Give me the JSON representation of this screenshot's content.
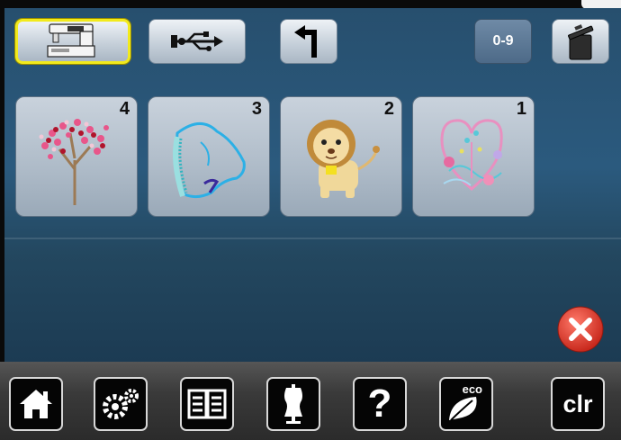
{
  "toolbar": {
    "machine_memory": "machine-icon",
    "usb_memory": "usb-icon",
    "back": "back-arrow-icon",
    "numeric_label": "0-9",
    "delete": "trash-icon"
  },
  "designs": [
    {
      "number": "4",
      "motif": "cherry-blossom-tree"
    },
    {
      "number": "3",
      "motif": "blue-dolphin"
    },
    {
      "number": "2",
      "motif": "lion-cub"
    },
    {
      "number": "1",
      "motif": "floral-heart"
    }
  ],
  "bottom_bar": {
    "home": "home-icon",
    "setup": "gears-icon",
    "tutorial": "book-icon",
    "advisor": "dress-form-icon",
    "help": "?",
    "eco_label": "eco",
    "clear_label": "clr"
  },
  "colors": {
    "panel": "#2b5a7e",
    "selected_border": "#f2ea1c",
    "close_red": "#e03a2a"
  }
}
